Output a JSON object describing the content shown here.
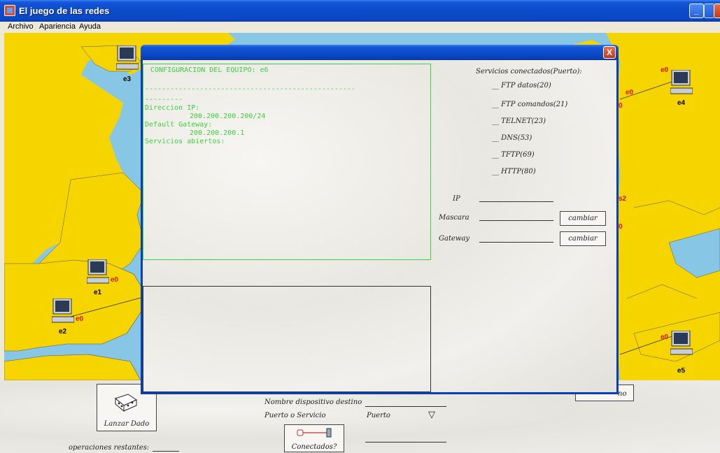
{
  "window": {
    "title": "El juego de las redes",
    "minimize_label": "_",
    "maximize_label": "□",
    "close_label": "X"
  },
  "menu": {
    "items": [
      {
        "label": "Archivo"
      },
      {
        "label": "Apariencia"
      },
      {
        "label": "Ayuda"
      }
    ]
  },
  "map": {
    "devices": [
      {
        "name": "e3"
      },
      {
        "name": "e4",
        "interface": "e0"
      },
      {
        "name": "e1",
        "interface": "e0"
      },
      {
        "name": "e2",
        "interface": "e0"
      },
      {
        "name": "e5",
        "interface": "e0"
      }
    ],
    "switch_labels": [
      "e0",
      "0",
      "s2",
      "0"
    ]
  },
  "dialog": {
    "close_label": "X",
    "config": {
      "header": "CONFIGURACION DEL EQUIPO: e6",
      "separator": "--------------------------------------------------",
      "separator_short": "---------",
      "ip_label": "Direccion IP:",
      "ip_value": "200.200.200.200/24",
      "gateway_label": "Default Gateway:",
      "gateway_value": "200.200.200.1",
      "services_label": "Servicios abiertos:"
    },
    "services_title": "Servicios conectados(Puerto):",
    "services": [
      "__ FTP datos(20)",
      "__ FTP comandos(21)",
      "__ TELNET(23)",
      "__ DNS(53)",
      "__ TFTP(69)",
      "__ HTTP(80)"
    ],
    "fields": {
      "ip_label": "IP",
      "mask_label": "Mascara",
      "gateway_label": "Gateway",
      "mask_button": "cambiar",
      "gateway_button": "cambiar"
    }
  },
  "bottom": {
    "dice_button": "Lanzar Dado",
    "operations_label": "operaciones restantes:",
    "dest_label": "Nombre dispositivo destino",
    "port_label": "Puerto o Servicio",
    "port_selected": "Puerto",
    "port_arrow": "▽",
    "connected_button": "Conectados?",
    "partial_button": "no"
  }
}
